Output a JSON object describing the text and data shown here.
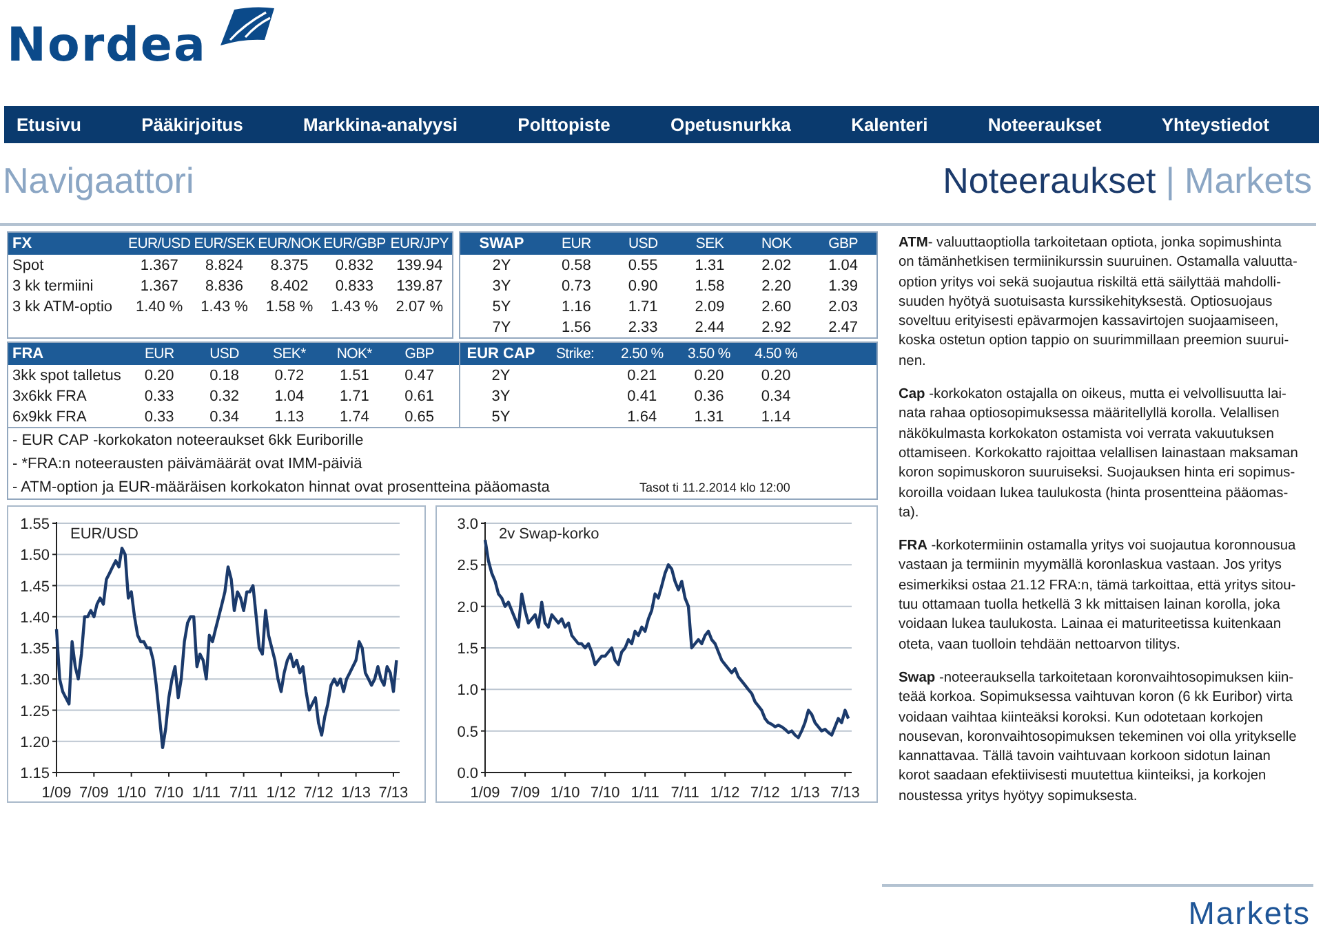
{
  "logo": {
    "text": "Nordea"
  },
  "nav": [
    "Etusivu",
    "Pääkirjoitus",
    "Markkina-analyysi",
    "Polttopiste",
    "Opetusnurkka",
    "Kalenteri",
    "Noteeraukset",
    "Yhteystiedot"
  ],
  "heading": {
    "title": "Navigaattori",
    "section": "Noteeraukset",
    "separator": "|",
    "subsection": "Markets"
  },
  "fx_table": {
    "title": "FX",
    "columns": [
      "EUR/USD",
      "EUR/SEK",
      "EUR/NOK",
      "EUR/GBP",
      "EUR/JPY"
    ],
    "rows": [
      {
        "label": "Spot",
        "values": [
          "1.367",
          "8.824",
          "8.375",
          "0.832",
          "139.94"
        ]
      },
      {
        "label": "3 kk termiini",
        "values": [
          "1.367",
          "8.836",
          "8.402",
          "0.833",
          "139.87"
        ]
      },
      {
        "label": "3 kk ATM-optio",
        "values": [
          "1.40 %",
          "1.43 %",
          "1.58 %",
          "1.43 %",
          "2.07 %"
        ]
      }
    ]
  },
  "swap_table": {
    "title": "SWAP",
    "columns": [
      "EUR",
      "USD",
      "SEK",
      "NOK",
      "GBP"
    ],
    "rows": [
      {
        "label": "2Y",
        "values": [
          "0.58",
          "0.55",
          "1.31",
          "2.02",
          "1.04"
        ]
      },
      {
        "label": "3Y",
        "values": [
          "0.73",
          "0.90",
          "1.58",
          "2.20",
          "1.39"
        ]
      },
      {
        "label": "5Y",
        "values": [
          "1.16",
          "1.71",
          "2.09",
          "2.60",
          "2.03"
        ]
      },
      {
        "label": "7Y",
        "values": [
          "1.56",
          "2.33",
          "2.44",
          "2.92",
          "2.47"
        ]
      }
    ]
  },
  "fra_table": {
    "title": "FRA",
    "columns": [
      "EUR",
      "USD",
      "SEK*",
      "NOK*",
      "GBP"
    ],
    "rows": [
      {
        "label": "3kk spot talletus",
        "values": [
          "0.20",
          "0.18",
          "0.72",
          "1.51",
          "0.47"
        ]
      },
      {
        "label": "3x6kk FRA",
        "values": [
          "0.33",
          "0.32",
          "1.04",
          "1.71",
          "0.61"
        ]
      },
      {
        "label": "6x9kk FRA",
        "values": [
          "0.33",
          "0.34",
          "1.13",
          "1.74",
          "0.65"
        ]
      }
    ]
  },
  "cap_table": {
    "title": "EUR CAP",
    "strike_label": "Strike:",
    "strikes": [
      "2.50 %",
      "3.50 %",
      "4.50 %"
    ],
    "rows": [
      {
        "label": "2Y",
        "values": [
          "0.21",
          "0.20",
          "0.20"
        ]
      },
      {
        "label": "3Y",
        "values": [
          "0.41",
          "0.36",
          "0.34"
        ]
      },
      {
        "label": "5Y",
        "values": [
          "1.64",
          "1.31",
          "1.14"
        ]
      }
    ]
  },
  "notes": {
    "lines": [
      "- EUR CAP -korkokaton noteeraukset 6kk Euriborille",
      "- *FRA:n noteerausten päivämäärät ovat IMM-päiviä",
      "- ATM-option ja EUR-määräisen korkokaton hinnat ovat prosentteina pääomasta"
    ],
    "timestamp": "Tasot ti 11.2.2014 klo 12:00"
  },
  "charts": [
    {
      "chart_data": {
        "type": "line",
        "grid": true,
        "categories": [
          "1/09",
          null,
          null,
          null,
          null,
          null,
          null,
          null,
          null,
          null,
          null,
          null,
          "7/09",
          null,
          null,
          null,
          null,
          null,
          null,
          null,
          null,
          null,
          null,
          null,
          "1/10",
          null,
          null,
          null,
          null,
          null,
          null,
          null,
          null,
          null,
          null,
          null,
          "7/10",
          null,
          null,
          null,
          null,
          null,
          null,
          null,
          null,
          null,
          null,
          null,
          "1/11",
          null,
          null,
          null,
          null,
          null,
          null,
          null,
          null,
          null,
          null,
          null,
          "7/11",
          null,
          null,
          null,
          null,
          null,
          null,
          null,
          null,
          null,
          null,
          null,
          "1/12",
          null,
          null,
          null,
          null,
          null,
          null,
          null,
          null,
          null,
          null,
          null,
          "7/12",
          null,
          null,
          null,
          null,
          null,
          null,
          null,
          null,
          null,
          null,
          null,
          "1/13",
          null,
          null,
          null,
          null,
          null,
          null,
          null,
          null,
          null,
          null,
          null,
          "7/13",
          null
        ],
        "series": [
          {
            "name": "EUR/USD",
            "color": "#1b3a6b",
            "values": [
              1.38,
              1.3,
              1.28,
              1.27,
              1.26,
              1.36,
              1.32,
              1.3,
              1.34,
              1.4,
              1.4,
              1.41,
              1.4,
              1.42,
              1.43,
              1.42,
              1.46,
              1.47,
              1.48,
              1.49,
              1.48,
              1.51,
              1.5,
              1.43,
              1.44,
              1.4,
              1.37,
              1.36,
              1.36,
              1.35,
              1.35,
              1.33,
              1.29,
              1.24,
              1.19,
              1.22,
              1.27,
              1.3,
              1.32,
              1.27,
              1.3,
              1.36,
              1.39,
              1.4,
              1.4,
              1.32,
              1.34,
              1.33,
              1.3,
              1.37,
              1.36,
              1.38,
              1.4,
              1.42,
              1.44,
              1.48,
              1.46,
              1.41,
              1.44,
              1.43,
              1.41,
              1.44,
              1.44,
              1.45,
              1.4,
              1.35,
              1.34,
              1.41,
              1.37,
              1.35,
              1.33,
              1.3,
              1.28,
              1.31,
              1.33,
              1.34,
              1.32,
              1.33,
              1.31,
              1.32,
              1.28,
              1.25,
              1.26,
              1.27,
              1.23,
              1.21,
              1.24,
              1.26,
              1.29,
              1.3,
              1.29,
              1.3,
              1.28,
              1.3,
              1.31,
              1.32,
              1.33,
              1.36,
              1.35,
              1.31,
              1.3,
              1.29,
              1.3,
              1.32,
              1.3,
              1.29,
              1.32,
              1.31,
              1.28,
              1.33
            ]
          }
        ],
        "ylim": [
          1.15,
          1.55
        ],
        "yticks": [
          {
            "value": 1.15,
            "label": "1.15"
          },
          {
            "value": 1.2,
            "label": "1.20"
          },
          {
            "value": 1.25,
            "label": "1.25"
          },
          {
            "value": 1.3,
            "label": "1.30"
          },
          {
            "value": 1.35,
            "label": "1.35"
          },
          {
            "value": 1.4,
            "label": "1.40"
          },
          {
            "value": 1.45,
            "label": "1.45"
          },
          {
            "value": 1.5,
            "label": "1.50"
          },
          {
            "value": 1.55,
            "label": "1.55"
          }
        ]
      }
    },
    {
      "chart_data": {
        "type": "line",
        "grid": true,
        "categories": [
          "1/09",
          null,
          null,
          null,
          null,
          null,
          null,
          null,
          null,
          null,
          null,
          null,
          "7/09",
          null,
          null,
          null,
          null,
          null,
          null,
          null,
          null,
          null,
          null,
          null,
          "1/10",
          null,
          null,
          null,
          null,
          null,
          null,
          null,
          null,
          null,
          null,
          null,
          "7/10",
          null,
          null,
          null,
          null,
          null,
          null,
          null,
          null,
          null,
          null,
          null,
          "1/11",
          null,
          null,
          null,
          null,
          null,
          null,
          null,
          null,
          null,
          null,
          null,
          "7/11",
          null,
          null,
          null,
          null,
          null,
          null,
          null,
          null,
          null,
          null,
          null,
          "1/12",
          null,
          null,
          null,
          null,
          null,
          null,
          null,
          null,
          null,
          null,
          null,
          "7/12",
          null,
          null,
          null,
          null,
          null,
          null,
          null,
          null,
          null,
          null,
          null,
          "1/13",
          null,
          null,
          null,
          null,
          null,
          null,
          null,
          null,
          null,
          null,
          null,
          "7/13",
          null
        ],
        "series": [
          {
            "name": "2v Swap-korko",
            "color": "#1b3a6b",
            "values": [
              2.8,
              2.55,
              2.4,
              2.3,
              2.15,
              2.1,
              2.0,
              2.05,
              1.95,
              1.85,
              1.75,
              2.15,
              1.95,
              1.8,
              1.85,
              1.9,
              1.75,
              2.05,
              1.8,
              1.75,
              1.9,
              1.85,
              1.8,
              1.85,
              1.75,
              1.8,
              1.65,
              1.6,
              1.55,
              1.55,
              1.5,
              1.55,
              1.45,
              1.3,
              1.35,
              1.4,
              1.4,
              1.45,
              1.5,
              1.35,
              1.3,
              1.45,
              1.5,
              1.6,
              1.55,
              1.7,
              1.65,
              1.75,
              1.7,
              1.85,
              1.95,
              2.15,
              2.1,
              2.25,
              2.4,
              2.5,
              2.45,
              2.3,
              2.2,
              2.3,
              2.1,
              2.0,
              1.5,
              1.55,
              1.6,
              1.55,
              1.65,
              1.7,
              1.6,
              1.55,
              1.45,
              1.35,
              1.3,
              1.25,
              1.2,
              1.25,
              1.15,
              1.1,
              1.05,
              1.0,
              0.95,
              0.85,
              0.8,
              0.75,
              0.65,
              0.6,
              0.58,
              0.55,
              0.57,
              0.55,
              0.52,
              0.48,
              0.5,
              0.45,
              0.42,
              0.5,
              0.6,
              0.75,
              0.7,
              0.6,
              0.55,
              0.5,
              0.52,
              0.48,
              0.45,
              0.55,
              0.65,
              0.6,
              0.75,
              0.65
            ]
          }
        ],
        "ylim": [
          0,
          3
        ],
        "yticks": [
          {
            "value": 0,
            "label": "0.0"
          },
          {
            "value": 0.5,
            "label": "0.5"
          },
          {
            "value": 1,
            "label": "1.0"
          },
          {
            "value": 1.5,
            "label": "1.5"
          },
          {
            "value": 2,
            "label": "2.0"
          },
          {
            "value": 2.5,
            "label": "2.5"
          },
          {
            "value": 3,
            "label": "3.0"
          }
        ]
      }
    }
  ],
  "info": {
    "paragraphs": [
      "**ATM**- valuuttaoptiolla tarkoitetaan optiota, jonka sopimushinta\non tämänhetkisen termiinikurssin suuruinen. Ostamalla valuutta-\noption yritys voi sekä suojautua riskiltä että säilyttää mahdolli-\nsuuden hyötyä suotuisasta kurssikehityksestä. Optiosuojaus\nsoveltuu erityisesti epävarmojen kassavirtojen suojaamiseen,\nkoska ostetun option tappio on suurimmillaan preemion suurui-\nnen.",
      "**Cap** -korkokaton ostajalla on oikeus, mutta ei velvollisuutta lai-\nnata rahaa optiosopimuksessa määritellyllä korolla. Velallisen\nnäkökulmasta korkokaton ostamista voi verrata vakuutuksen\nottamiseen. Korkokatto rajoittaa velallisen lainastaan maksaman\nkoron sopimuskoron suuruiseksi. Suojauksen hinta eri sopimus-\nkoroilla voidaan lukea taulukosta (hinta prosentteina pääomas-\nta).",
      "**FRA** -korkotermiinin ostamalla yritys voi suojautua koronnousua\nvastaan ja termiinin myymällä koronlaskua vastaan. Jos yritys\nesimerkiksi ostaa 21.12 FRA:n, tämä tarkoittaa, että yritys sitou-\ntuu ottamaan tuolla hetkellä 3 kk mittaisen lainan korolla, joka\nvoidaan lukea taulukosta. Lainaa ei maturiteetissa kuitenkaan\noteta, vaan tuolloin tehdään nettoarvon tilitys.",
      "**Swap** -noteerauksella tarkoitetaan koronvaihtosopimuksen kiin-\nteää korkoa. Sopimuksessa vaihtuvan koron (6 kk Euribor) virta\nvoidaan vaihtaa kiinteäksi koroksi. Kun odotetaan korkojen\nnousevan, koronvaihtosopimuksen tekeminen voi olla yritykselle\nkannattavaa. Tällä tavoin vaihtuvaan korkoon sidotun lainan\nkorot saadaan efektiivisesti muutettua kiinteiksi, ja korkojen\nnoustessa yritys hyötyy sopimuksesta."
    ]
  },
  "footer": {
    "brand": "Markets"
  }
}
